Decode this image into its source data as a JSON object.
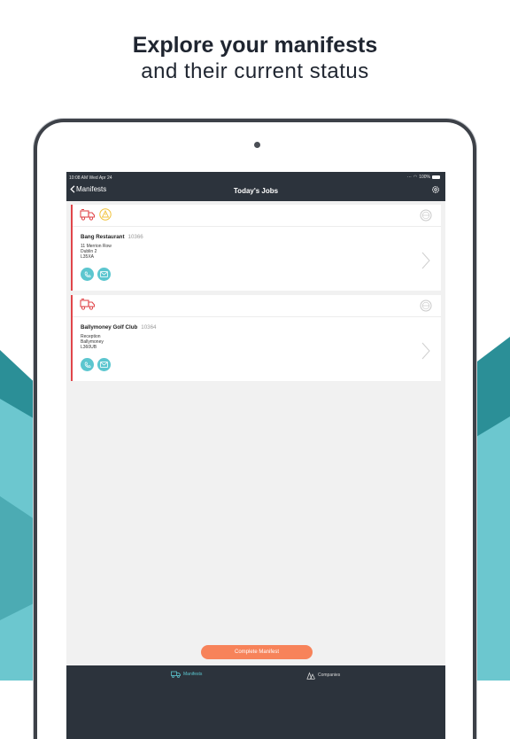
{
  "headline": {
    "line1": "Explore your manifests",
    "line2": "and their current status"
  },
  "colors": {
    "teal": "#6cc7cf",
    "dark_teal": "#2b8f97",
    "navbar": "#2c333c",
    "accent_red": "#e0464a",
    "orange": "#f7835a"
  },
  "status_bar": {
    "time": "10:08 AM  Wed Apr 24",
    "battery": "100%"
  },
  "navbar": {
    "back_label": "Manifests",
    "title": "Today's Jobs"
  },
  "jobs": [
    {
      "name": "Bang Restaurant",
      "number": "10366",
      "address": [
        "11 Merrion Row",
        "Dublin 2",
        "L35XA"
      ],
      "icons": [
        "delivery-truck-icon",
        "warning-icon"
      ]
    },
    {
      "name": "Ballymoney Golf Club",
      "number": "10364",
      "address": [
        "Reception",
        "Ballymoney",
        "L360UB"
      ],
      "icons": [
        "delivery-truck-icon"
      ]
    }
  ],
  "complete_button": "Complete Manifest",
  "tabs": [
    {
      "label": "Manifests",
      "icon": "manifests-icon",
      "active": true
    },
    {
      "label": "Companies",
      "icon": "companies-icon",
      "active": false
    }
  ]
}
